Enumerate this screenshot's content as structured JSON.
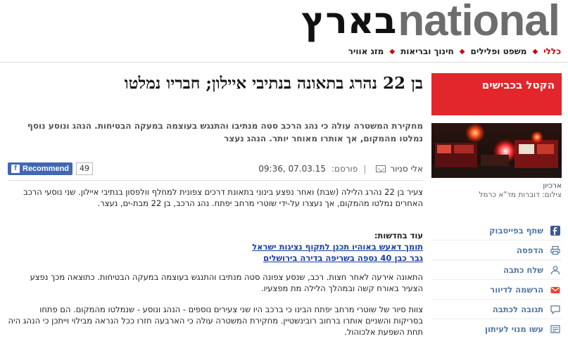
{
  "logo": {
    "hebrew": "בארץ",
    "english": "national"
  },
  "nav": {
    "items": [
      {
        "label": "כללי",
        "active": true
      },
      {
        "label": "משפט ופלילים",
        "active": false
      },
      {
        "label": "חינוך ובריאות",
        "active": false
      },
      {
        "label": "מזג אוויר",
        "active": false
      }
    ],
    "separator": "◆"
  },
  "article": {
    "headline": "בן 22 נהרג בתאונה בנתיבי איילון; חבריו נמלטו",
    "subtitle": "מחקירת המשטרה עולה כי נהג הרכב סטה מנתיבו והתנגש בעוצמה במעקה הבטיחות. הנהג ונוסע נוסף נמלטו מהמקום, אך אותרו מאוחר יותר. הנהג נעצר",
    "author": "אלי סניור",
    "published_label": "פורסם:",
    "date": "07.03.15 ,09:36",
    "fb_recommend": "Recommend",
    "fb_count": "49",
    "p1": "צעיר בן 22 נהרג הלילה (שבת) ואחר נפצע בינוני בתאונת דרכים צפונית למחלף וולפסון בנתיבי איילון. שני נוסעי הרכב האחרים נמלטו מהמקום, אך נעצרו על-ידי שוטרי מרחב יפתח. נהג הרכב, בן 22 מבת-ים, נעצר.",
    "more_title": "עוד בחדשות:",
    "more_links": [
      "תומך דאעש באוהיו תכנן לתקוף נציגות ישראל",
      "גבר כבן 40 נספה בשריפה בדירה בירושלים"
    ],
    "p2": "התאונה אירעה לאחר חצות. רכב, שנסע צפונה סטה מנתיבו והתנגש בעוצמה במעקה הבטיחות. כתוצאה מכך נפצע הצעיר באורח קשה ובמהלך הלילה מת מפצעיו.",
    "p3": "צוות סיור של שוטרי מרחב יפתח הבינו כי ברכב היו שני צעירים נוספים - הנהג ונוסע - שנמלטו מהמקום. הם פתחו בסריקות והשניים אותרו ברחוב רובינשטיין. מחקירת המשטרה עולה כי הארבעה חזרו ככל הנראה מבילוי וייתכן כי הנהג היה תחת השפעת אלכוהול."
  },
  "sidebar": {
    "promo": "הקטל בכבישים",
    "caption_title": "ארכיון",
    "caption_credit": "צילום: דוברות מד\"א כרמל",
    "share": [
      {
        "label": "שתף בפייסבוק",
        "icon": "facebook-icon"
      },
      {
        "label": "הדפסה",
        "icon": "print-icon"
      },
      {
        "label": "שלח כתבה",
        "icon": "person-icon"
      },
      {
        "label": "הרשמה לדיוור",
        "icon": "mail-icon"
      },
      {
        "label": "תגובה לכתבה",
        "icon": "comment-icon"
      },
      {
        "label": "עשו מנוי לעיתון",
        "icon": "newspaper-icon"
      }
    ]
  },
  "colors": {
    "accent": "#e3262b",
    "link": "#1a3fa3",
    "share_text": "#5577a0"
  }
}
